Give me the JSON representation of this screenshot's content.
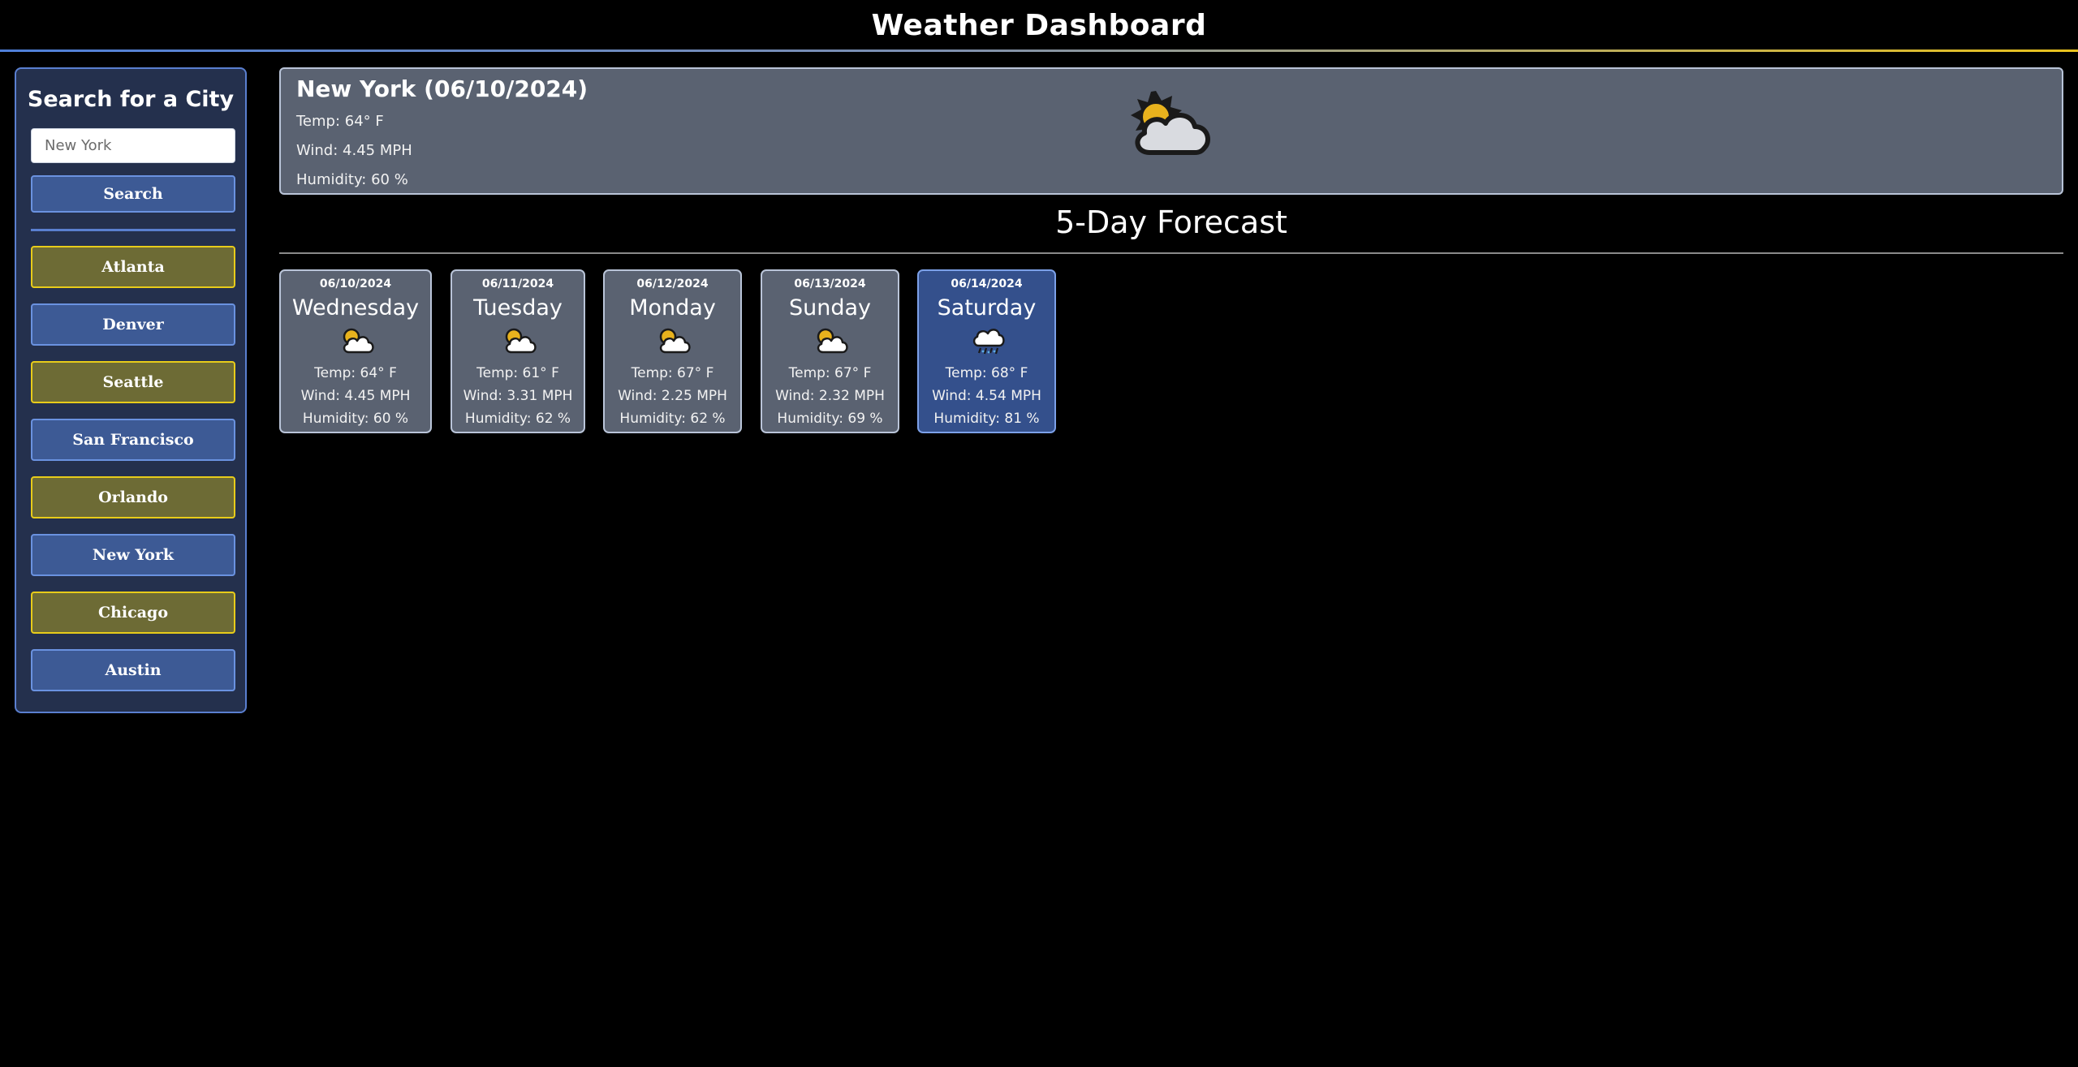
{
  "header": {
    "title": "Weather Dashboard"
  },
  "sidebar": {
    "title": "Search for a City",
    "search_placeholder": "New York",
    "search_label": "Search",
    "cities": [
      {
        "label": "Atlanta",
        "style": "gold"
      },
      {
        "label": "Denver",
        "style": "blue"
      },
      {
        "label": "Seattle",
        "style": "gold"
      },
      {
        "label": "San Francisco",
        "style": "blue"
      },
      {
        "label": "Orlando",
        "style": "gold"
      },
      {
        "label": "New York",
        "style": "blue"
      },
      {
        "label": "Chicago",
        "style": "gold"
      },
      {
        "label": "Austin",
        "style": "blue"
      }
    ]
  },
  "current": {
    "title": "New York (06/10/2024)",
    "temp": "Temp: 64° F",
    "wind": "Wind: 4.45 MPH",
    "humidity": "Humidity: 60 %",
    "icon": "partly-cloudy-icon"
  },
  "forecast": {
    "title": "5-Day Forecast",
    "days": [
      {
        "date": "06/10/2024",
        "day": "Wednesday",
        "icon": "partly-cloudy-icon",
        "temp": "Temp: 64° F",
        "wind": "Wind: 4.45 MPH",
        "humidity": "Humidity: 60 %"
      },
      {
        "date": "06/11/2024",
        "day": "Tuesday",
        "icon": "partly-cloudy-icon",
        "temp": "Temp: 61° F",
        "wind": "Wind: 3.31 MPH",
        "humidity": "Humidity: 62 %"
      },
      {
        "date": "06/12/2024",
        "day": "Monday",
        "icon": "partly-cloudy-icon",
        "temp": "Temp: 67° F",
        "wind": "Wind: 2.25 MPH",
        "humidity": "Humidity: 62 %"
      },
      {
        "date": "06/13/2024",
        "day": "Sunday",
        "icon": "partly-cloudy-icon",
        "temp": "Temp: 67° F",
        "wind": "Wind: 2.32 MPH",
        "humidity": "Humidity: 69 %"
      },
      {
        "date": "06/14/2024",
        "day": "Saturday",
        "icon": "rain-cloud-icon",
        "temp": "Temp: 68° F",
        "wind": "Wind: 4.54 MPH",
        "humidity": "Humidity: 81 %"
      }
    ]
  },
  "colors": {
    "gold_button": "#6d6b35",
    "gold_border": "#e8cc1a",
    "blue_button": "#3d5a95",
    "blue_border": "#6a92e0",
    "card_bg": "#5a6271",
    "rain_card_bg": "#34508c"
  }
}
